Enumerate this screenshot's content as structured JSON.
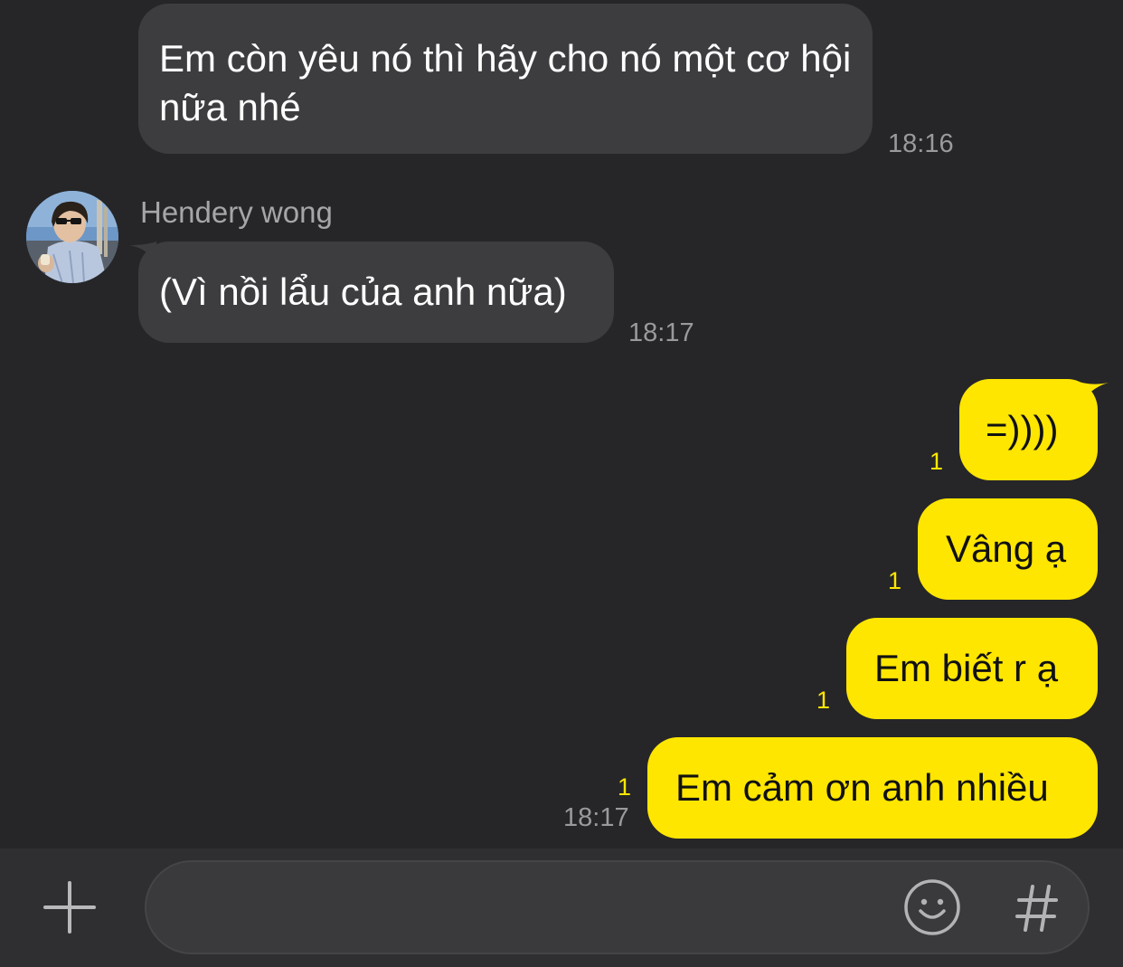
{
  "messages": {
    "m1": {
      "text": "Em còn yêu nó thì hãy cho nó một cơ hội nữa nhé",
      "time": "18:16"
    },
    "sender_name": "Hendery wong",
    "m2": {
      "text": "(Vì nồi lẩu của anh nữa)",
      "time": "18:17"
    },
    "outgoing": [
      {
        "text": "=))))",
        "unread": "1"
      },
      {
        "text": "Vâng ạ",
        "unread": "1"
      },
      {
        "text": "Em biết r ạ",
        "unread": "1"
      },
      {
        "text": "Em cảm ơn anh nhiều",
        "unread": "1",
        "time": "18:17"
      }
    ]
  },
  "composer": {
    "placeholder": "",
    "add_icon": "plus-icon",
    "emoji_icon": "smiley-icon",
    "hashtag_icon": "hashtag-icon"
  },
  "colors": {
    "background": "#262628",
    "incoming_bubble": "#3d3d40",
    "outgoing_bubble": "#ffe600",
    "unread_count": "#ffe600",
    "timestamp": "#9a9a9c"
  }
}
